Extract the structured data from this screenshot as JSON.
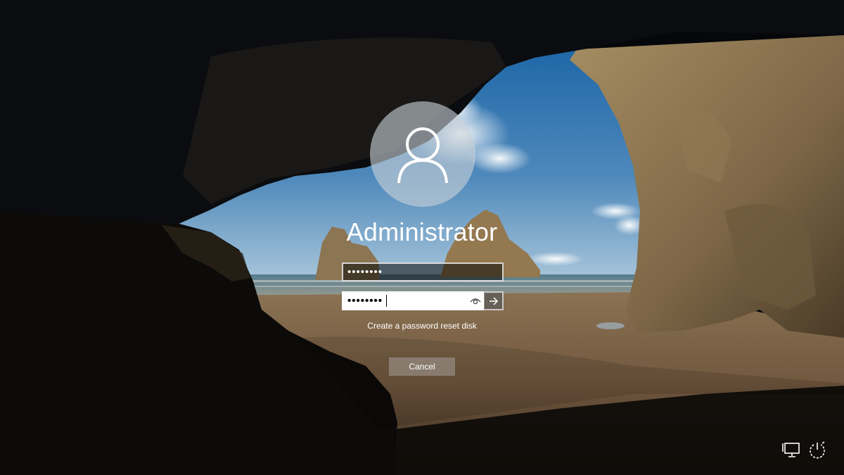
{
  "user": {
    "name": "Administrator"
  },
  "form": {
    "current_password": "••••••••",
    "new_password": "••••••••",
    "reset_link": "Create a password reset disk",
    "cancel_label": "Cancel"
  },
  "icons": {
    "avatar": "user-silhouette-icon",
    "reveal": "eye-icon",
    "submit": "arrow-right-icon",
    "network": "network-icon",
    "power": "power-icon"
  },
  "colors": {
    "cancel_button": "#968c82",
    "text": "#ffffff"
  }
}
